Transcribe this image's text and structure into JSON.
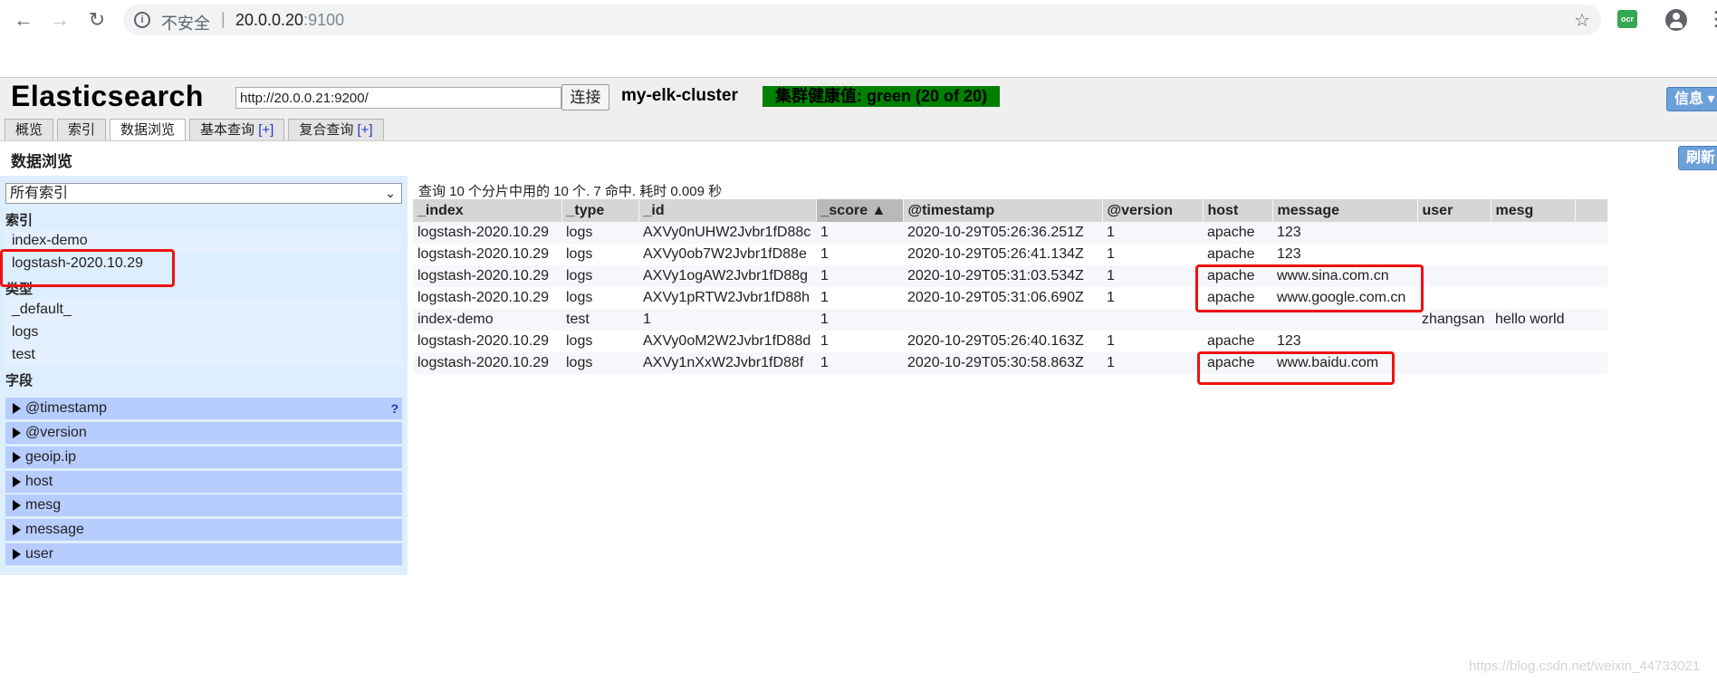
{
  "browser": {
    "back_icon": "arrow-left-icon",
    "forward_icon": "arrow-right-icon",
    "reload_icon": "reload-icon",
    "security_label": "不安全",
    "separator": "|",
    "url_host": "20.0.0.20",
    "url_port": ":9100"
  },
  "app": {
    "title": "Elasticsearch",
    "connect_url": "http://20.0.0.21:9200/",
    "connect_label": "连接",
    "cluster_name": "my-elk-cluster",
    "health": "集群健康值: green (20 of 20)",
    "health_color": "#008000",
    "info_label": "信息",
    "tabs": [
      {
        "label": "概览",
        "plus": ""
      },
      {
        "label": "索引",
        "plus": ""
      },
      {
        "label": "数据浏览",
        "plus": ""
      },
      {
        "label": "基本查询 ",
        "plus": "[+]"
      },
      {
        "label": "复合查询 ",
        "plus": "[+]"
      }
    ]
  },
  "section": {
    "title": "数据浏览",
    "refresh_label": "刷新"
  },
  "sidebar": {
    "select_value": "所有索引",
    "indices_heading": "索引",
    "indices": [
      "index-demo",
      "logstash-2020.10.29"
    ],
    "types_heading": "类型",
    "types": [
      "_default_",
      "logs",
      "test"
    ],
    "fields_heading": "字段",
    "fields": [
      "@timestamp",
      "@version",
      "geoip.ip",
      "host",
      "mesg",
      "message",
      "user"
    ],
    "help_mark": "?"
  },
  "results": {
    "summary": "查询 10 个分片中用的 10 个. 7 命中. 耗时 0.009 秒",
    "columns": [
      "_index",
      "_type",
      "_id",
      "_score ▲",
      "@timestamp",
      "@version",
      "host",
      "message",
      "user",
      "mesg"
    ],
    "rows": [
      [
        "logstash-2020.10.29",
        "logs",
        "AXVy0nUHW2Jvbr1fD88c",
        "1",
        "2020-10-29T05:26:36.251Z",
        "1",
        "apache",
        "123",
        "",
        ""
      ],
      [
        "logstash-2020.10.29",
        "logs",
        "AXVy0ob7W2Jvbr1fD88e",
        "1",
        "2020-10-29T05:26:41.134Z",
        "1",
        "apache",
        "123",
        "",
        ""
      ],
      [
        "logstash-2020.10.29",
        "logs",
        "AXVy1ogAW2Jvbr1fD88g",
        "1",
        "2020-10-29T05:31:03.534Z",
        "1",
        "apache",
        "www.sina.com.cn",
        "",
        ""
      ],
      [
        "logstash-2020.10.29",
        "logs",
        "AXVy1pRTW2Jvbr1fD88h",
        "1",
        "2020-10-29T05:31:06.690Z",
        "1",
        "apache",
        "www.google.com.cn",
        "",
        ""
      ],
      [
        "index-demo",
        "test",
        "1",
        "1",
        "",
        "",
        "",
        "",
        "zhangsan",
        "hello world"
      ],
      [
        "logstash-2020.10.29",
        "logs",
        "AXVy0oM2W2Jvbr1fD88d",
        "1",
        "2020-10-29T05:26:40.163Z",
        "1",
        "apache",
        "123",
        "",
        ""
      ],
      [
        "logstash-2020.10.29",
        "logs",
        "AXVy1nXxW2Jvbr1fD88f",
        "1",
        "2020-10-29T05:30:58.863Z",
        "1",
        "apache",
        "www.baidu.com",
        "",
        ""
      ]
    ]
  },
  "watermark": "https://blog.csdn.net/weixin_44733021"
}
